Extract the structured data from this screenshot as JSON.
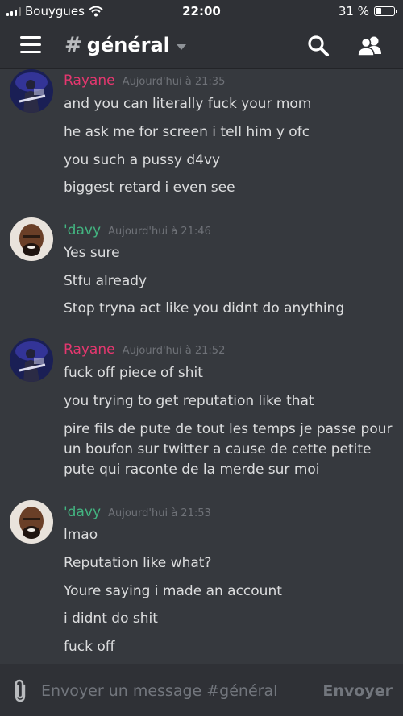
{
  "status_bar": {
    "carrier": "Bouygues",
    "time": "22:00",
    "battery": "31 %",
    "battery_level": 0.31
  },
  "header": {
    "hash": "#",
    "channel": "général"
  },
  "colors": {
    "rayane": "#e5376f",
    "davy": "#43b581"
  },
  "messages": [
    {
      "author": "Rayane",
      "timestamp": "Aujourd'hui à 21:35",
      "avatar": "guitarist-avatar",
      "lines": [
        "and you can literally fuck your mom",
        "he ask me for screen i tell him y ofc",
        "you such a pussy d4vy",
        "biggest retard i even see"
      ]
    },
    {
      "author": "'davy",
      "timestamp": "Aujourd'hui à 21:46",
      "avatar": "bald-man-avatar",
      "lines": [
        "Yes sure",
        "Stfu already",
        "Stop tryna act like you didnt do anything"
      ]
    },
    {
      "author": "Rayane",
      "timestamp": "Aujourd'hui à 21:52",
      "avatar": "guitarist-avatar",
      "lines": [
        "fuck off piece of shit",
        "you trying to get reputation like that",
        [
          "pire fils de pute de tout les temps je passe pour",
          "un boufon sur twitter a cause de cette petite",
          "pute qui raconte de la merde sur moi"
        ]
      ]
    },
    {
      "author": "'davy",
      "timestamp": "Aujourd'hui à 21:53",
      "avatar": "bald-man-avatar",
      "lines": [
        "lmao",
        "Reputation like what?",
        "Youre saying i made an account",
        "i didnt do shit",
        "fuck off"
      ]
    }
  ],
  "composer": {
    "placeholder": "Envoyer un message #général",
    "send_label": "Envoyer"
  }
}
